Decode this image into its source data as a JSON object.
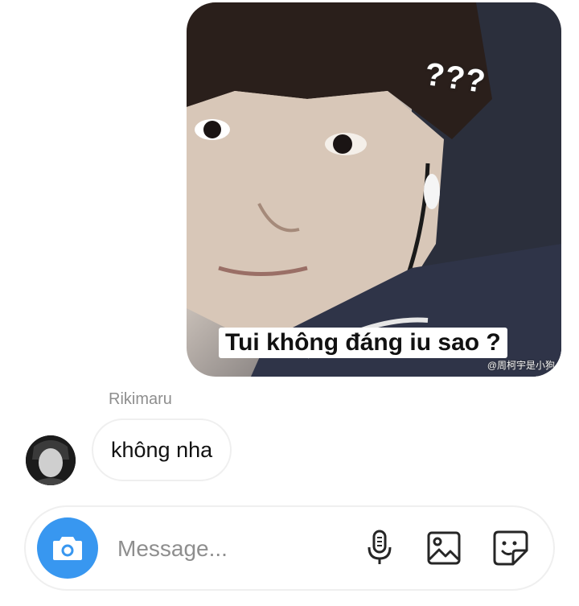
{
  "thread": {
    "sent_image": {
      "caption": "Tui không đáng iu sao ?",
      "overlay_marks": "???",
      "watermark": "@周柯宇是小狗"
    },
    "received": {
      "sender_name": "Rikimaru",
      "text": "không nha"
    }
  },
  "composer": {
    "placeholder": "Message...",
    "icons": [
      "camera-icon",
      "microphone-icon",
      "gallery-icon",
      "sticker-icon"
    ],
    "accent_color": "#3897f0"
  }
}
